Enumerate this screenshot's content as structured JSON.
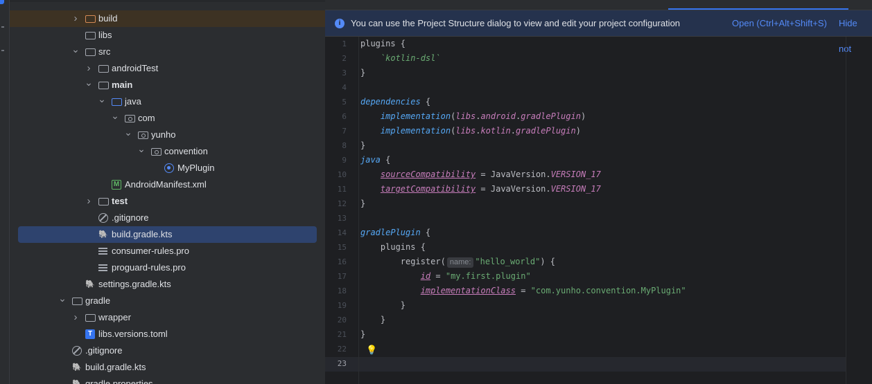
{
  "tree": {
    "rows": [
      {
        "label": "build",
        "depth": 2,
        "icon": "folder-orange-icon",
        "chev": "right"
      },
      {
        "label": "libs",
        "depth": 2,
        "icon": "folder-icon",
        "chev": ""
      },
      {
        "label": "src",
        "depth": 2,
        "icon": "folder-icon",
        "chev": "down"
      },
      {
        "label": "androidTest",
        "depth": 3,
        "icon": "folder-icon",
        "chev": "right"
      },
      {
        "label": "main",
        "depth": 3,
        "icon": "source-folder-icon",
        "chev": "down",
        "bold": true
      },
      {
        "label": "java",
        "depth": 4,
        "icon": "folder-blue-icon",
        "chev": "down"
      },
      {
        "label": "com",
        "depth": 5,
        "icon": "package-icon",
        "chev": "down"
      },
      {
        "label": "yunho",
        "depth": 6,
        "icon": "package-icon",
        "chev": "down"
      },
      {
        "label": "convention",
        "depth": 7,
        "icon": "package-icon",
        "chev": "down"
      },
      {
        "label": "MyPlugin",
        "depth": 8,
        "icon": "kotlin-class-icon",
        "chev": ""
      },
      {
        "label": "AndroidManifest.xml",
        "depth": 4,
        "icon": "manifest-icon",
        "chev": ""
      },
      {
        "label": "test",
        "depth": 3,
        "icon": "source-folder-icon",
        "chev": "right",
        "bold": true
      },
      {
        "label": ".gitignore",
        "depth": 3,
        "icon": "ignore-file-icon",
        "chev": ""
      },
      {
        "label": "build.gradle.kts",
        "depth": 3,
        "icon": "gradle-icon",
        "chev": "",
        "selected": true
      },
      {
        "label": "consumer-rules.pro",
        "depth": 3,
        "icon": "text-file-icon",
        "chev": ""
      },
      {
        "label": "proguard-rules.pro",
        "depth": 3,
        "icon": "text-file-icon",
        "chev": ""
      },
      {
        "label": "settings.gradle.kts",
        "depth": 2,
        "icon": "gradle-icon",
        "chev": ""
      },
      {
        "label": "gradle",
        "depth": 1,
        "icon": "folder-icon",
        "chev": "down"
      },
      {
        "label": "wrapper",
        "depth": 2,
        "icon": "folder-icon",
        "chev": "right"
      },
      {
        "label": "libs.versions.toml",
        "depth": 2,
        "icon": "toml-icon",
        "chev": ""
      },
      {
        "label": ".gitignore",
        "depth": 1,
        "icon": "ignore-file-icon",
        "chev": ""
      },
      {
        "label": "build.gradle.kts",
        "depth": 1,
        "icon": "gradle-icon",
        "chev": ""
      },
      {
        "label": "gradle.properties",
        "depth": 1,
        "icon": "gradle-icon",
        "chev": ""
      }
    ]
  },
  "banner": {
    "message": "You can use the Project Structure dialog to view and edit your project configuration",
    "open_link": "Open (Ctrl+Alt+Shift+S)",
    "hide_link": "Hide not"
  },
  "editor": {
    "line_numbers": [
      "1",
      "2",
      "3",
      "4",
      "5",
      "6",
      "7",
      "8",
      "9",
      "10",
      "11",
      "12",
      "13",
      "14",
      "15",
      "16",
      "17",
      "18",
      "19",
      "20",
      "21",
      "22",
      "23"
    ],
    "current_line": "23",
    "hint_name": "name:",
    "tokens": {
      "plugins": "plugins",
      "kotlin_dsl": "`kotlin-dsl`",
      "dependencies": "dependencies",
      "implementation": "implementation",
      "libs": "libs",
      "android": "android",
      "kotlin": "kotlin",
      "gradlePlugin": "gradlePlugin",
      "java": "java",
      "sourceCompatibility": "sourceCompatibility",
      "targetCompatibility": "targetCompatibility",
      "JavaVersion": "JavaVersion",
      "VERSION_17": "VERSION_17",
      "register": "register",
      "hello_world": "\"hello_world\"",
      "id": "id",
      "plugin_id": "\"my.first.plugin\"",
      "implementationClass": "implementationClass",
      "impl_class_val": "\"com.yunho.convention.MyPlugin\""
    }
  }
}
